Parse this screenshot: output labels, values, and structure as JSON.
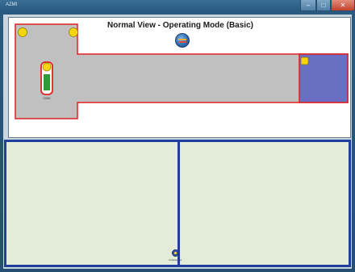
{
  "window": {
    "title": "AZMI",
    "minimize_glyph": "–",
    "maximize_glyph": "□",
    "close_glyph": "✕"
  },
  "top_view": {
    "title": "Normal View - Operating Mode (Basic)",
    "logo": "blue-orange-globe-icon",
    "floor_fill": "#c0c0c0",
    "outline_color": "#e02020",
    "zone_fill": "#6b6fc4",
    "marker_color": "#f5d60e",
    "device_label": "0006"
  },
  "bottom_view": {
    "pane_fill": "#e2ecd8",
    "divider_color": "#1e3f9a",
    "sensor_label": "Unassigned"
  }
}
